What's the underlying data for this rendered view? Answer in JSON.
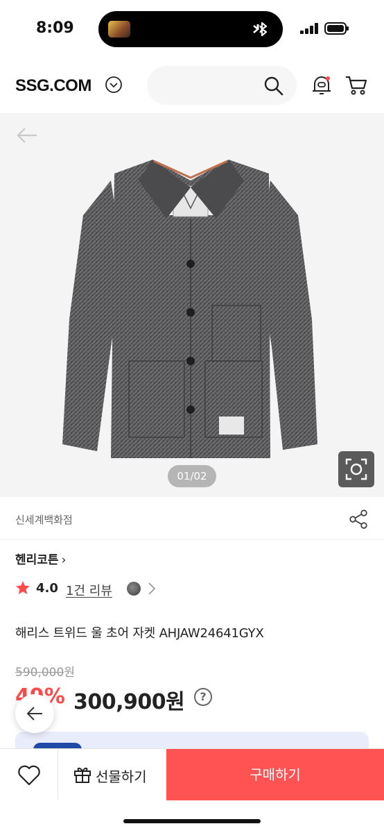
{
  "status_bar": {
    "time": "8:09"
  },
  "header": {
    "logo": "SSG.COM",
    "search_placeholder": ""
  },
  "gallery": {
    "counter": "01/02"
  },
  "store": {
    "name": "신세계백화점"
  },
  "product": {
    "brand": "헨리코튼",
    "brand_chevron": "›",
    "rating": "4.0",
    "review_link": "1건 리뷰",
    "title": "해리스 트위드 울 초어 자켓 AHJAW24641GYX",
    "original_price": "590,000",
    "original_price_unit": "원",
    "discount": "49%",
    "price": "300,900원",
    "help": "?"
  },
  "bottom_bar": {
    "gift_label": "선물하기",
    "buy_label": "구매하기"
  },
  "colors": {
    "accent": "#ff5252",
    "discount": "#ff4a4a",
    "star": "#ff4a4a"
  },
  "icons": [
    "bluetooth-icon",
    "signal-icon",
    "battery-icon",
    "chevron-down-icon",
    "search-icon",
    "bell-icon",
    "cart-icon",
    "back-arrow-icon",
    "camera-lens-icon",
    "share-icon",
    "star-icon",
    "chevron-right-icon",
    "heart-icon",
    "gift-icon"
  ]
}
